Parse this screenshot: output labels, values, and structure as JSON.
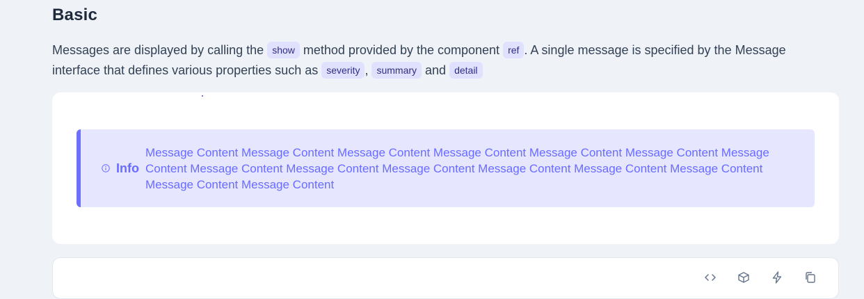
{
  "section": {
    "title": "Basic"
  },
  "intro": {
    "text_1": "Messages are displayed by calling the ",
    "code_show": "show",
    "text_2": " method provided by the component ",
    "code_ref": "ref",
    "text_3": ". A single message is specified by the Message interface that defines various properties such as ",
    "code_severity": "severity",
    "text_4": ", ",
    "code_summary": "summary",
    "text_5": " and ",
    "code_detail": "detail"
  },
  "message": {
    "severity_icon": "info-circle-icon",
    "summary": "Info",
    "detail": "Message Content Message Content Message Content Message Content Message Content Message Content Message Content Message Content Message Content Message Content Message Content Message Content Message Content Message Content Message Content",
    "colors": {
      "background": "#e6e6fe",
      "border": "#6e6eff",
      "text": "#696cff"
    }
  },
  "code_toolbar": {
    "buttons": [
      {
        "icon": "code-icon"
      },
      {
        "icon": "box-icon"
      },
      {
        "icon": "bolt-icon"
      },
      {
        "icon": "copy-icon"
      }
    ]
  },
  "colors": {
    "page_background": "#eff3f8",
    "card_background": "#ffffff",
    "code_chip_background": "#e0e1ff"
  }
}
